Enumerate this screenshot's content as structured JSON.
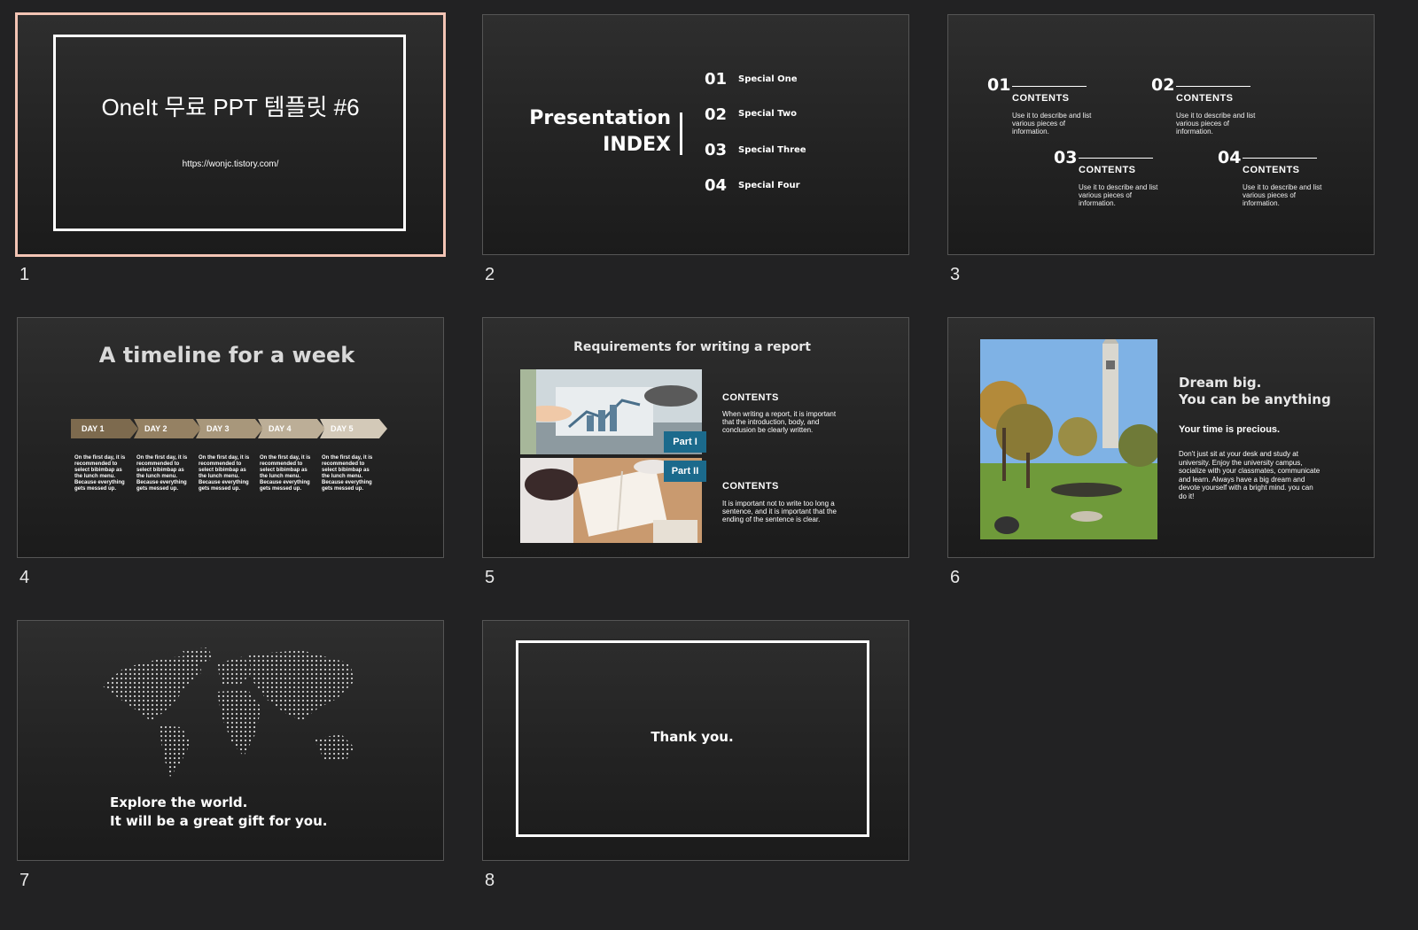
{
  "slides": [
    {
      "number": "1",
      "title": "OneIt 무료 PPT 템플릿 #6",
      "url": "https://wonjc.tistory.com/"
    },
    {
      "number": "2",
      "heading_line1": "Presentation",
      "heading_line2": "INDEX",
      "items": [
        {
          "num": "01",
          "label": "Special One"
        },
        {
          "num": "02",
          "label": "Special Two"
        },
        {
          "num": "03",
          "label": "Special Three"
        },
        {
          "num": "04",
          "label": "Special Four"
        }
      ]
    },
    {
      "number": "3",
      "items": [
        {
          "num": "01",
          "title": "CONTENTS",
          "desc": "Use it to describe and list various pieces of information."
        },
        {
          "num": "02",
          "title": "CONTENTS",
          "desc": "Use it to describe and list various pieces of information."
        },
        {
          "num": "03",
          "title": "CONTENTS",
          "desc": "Use it to describe and list various pieces of information."
        },
        {
          "num": "04",
          "title": "CONTENTS",
          "desc": "Use it to describe and list various pieces of information."
        }
      ]
    },
    {
      "number": "4",
      "title": "A timeline for a week",
      "days": [
        {
          "label": "DAY 1",
          "color": "#7d6a4e",
          "text": "On the first day, it is recommended to select bibimbap as the lunch menu. Because everything gets messed up."
        },
        {
          "label": "DAY 2",
          "color": "#958163",
          "text": "On the first day, it is recommended to select bibimbap as the lunch menu. Because everything gets messed up."
        },
        {
          "label": "DAY 3",
          "color": "#a8977b",
          "text": "On the first day, it is recommended to select bibimbap as the lunch menu. Because everything gets messed up."
        },
        {
          "label": "DAY 4",
          "color": "#bcae97",
          "text": "On the first day, it is recommended to select bibimbap as the lunch menu. Because everything gets messed up."
        },
        {
          "label": "DAY 5",
          "color": "#d3c9b8",
          "text": "On the first day, it is recommended to select bibimbap as the lunch menu. Because everything gets messed up."
        }
      ]
    },
    {
      "number": "5",
      "title": "Requirements for writing a report",
      "part1": "Part I",
      "part2": "Part II",
      "c1_title": "CONTENTS",
      "c1_text": "When writing a report, it is important that the introduction, body, and conclusion be clearly written.",
      "c2_title": "CONTENTS",
      "c2_text": "It is important not to write too long a sentence, and it is important that the ending of the sentence is clear."
    },
    {
      "number": "6",
      "heading1": "Dream big.",
      "heading2": "You can be anything",
      "sub": "Your time is precious.",
      "text": "Don't just sit at your desk and study at university. Enjoy the university campus, socialize with your classmates, communicate and learn. Always have a big dream and devote yourself with a bright mind. you can do it!"
    },
    {
      "number": "7",
      "line1": "Explore the world.",
      "line2": "It will be a great gift for you."
    },
    {
      "number": "8",
      "text": "Thank you."
    }
  ]
}
